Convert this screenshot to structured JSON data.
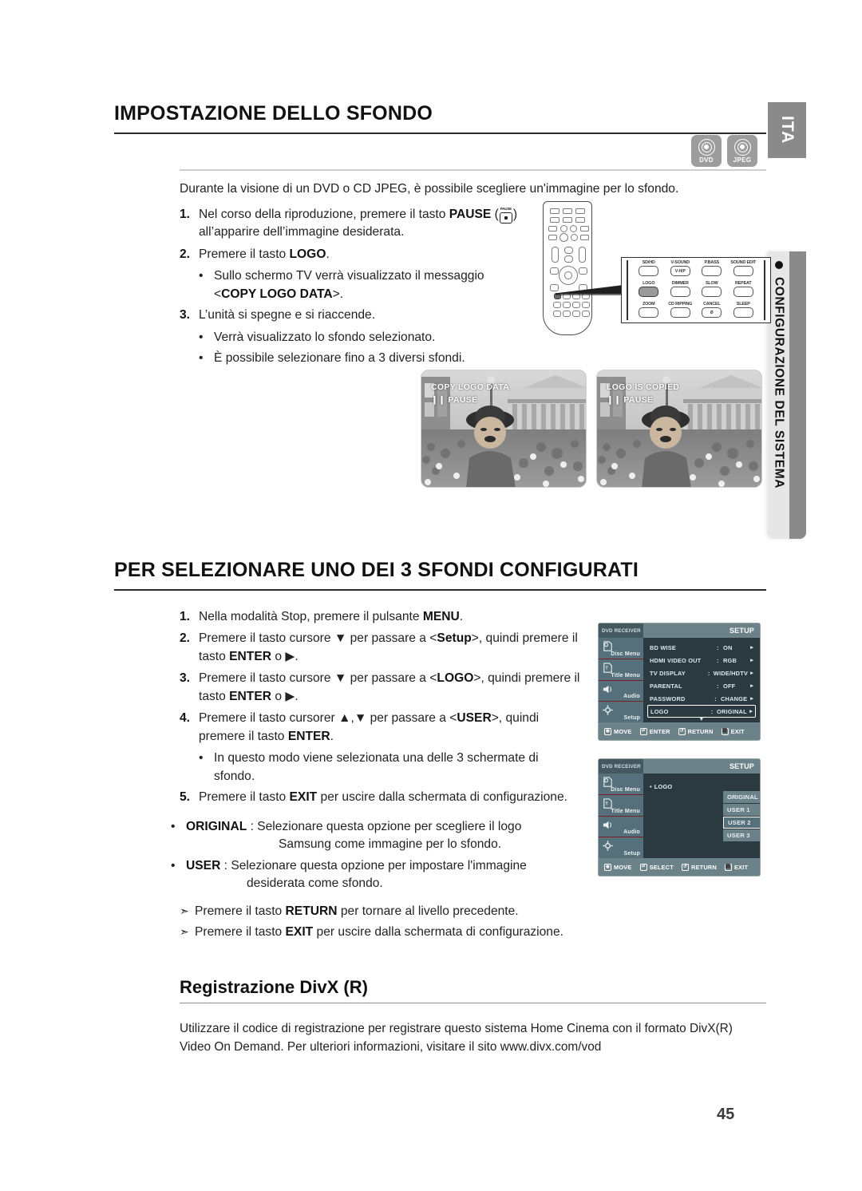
{
  "page": {
    "number": "45",
    "language_tab": "ITA",
    "chapter_tab": "CONFIGURAZIONE DEL SISTEMA"
  },
  "section1": {
    "heading": "IMPOSTAZIONE DELLO SFONDO",
    "badges": [
      {
        "label": "DVD",
        "icon": "disc-icon"
      },
      {
        "label": "JPEG",
        "icon": "disc-icon"
      }
    ],
    "intro": "Durante la visione di un DVD o CD JPEG, è possibile scegliere un'immagine per lo sfondo.",
    "steps": [
      {
        "num": "1.",
        "pre": "Nel corso della riproduzione, premere il tasto ",
        "bold": "PAUSE",
        "post": " (",
        "post2": ")",
        "line2": "all’apparire dell’immagine desiderata.",
        "bullets": []
      },
      {
        "num": "2.",
        "pre": "Premere il tasto ",
        "bold": "LOGO",
        "post": ".",
        "bullets": [
          {
            "pre": "Sullo schermo TV verrà visualizzato il messaggio",
            "line2_pre": "<",
            "line2_bold": "COPY LOGO DATA",
            "line2_post": ">."
          }
        ]
      },
      {
        "num": "3.",
        "pre": "L’unità si spegne e si riaccende.",
        "bold": "",
        "post": "",
        "bullets": [
          {
            "pre": "Verrà visualizzato lo sfondo selezionato."
          },
          {
            "pre": "È possibile selezionare fino a 3 diversi sfondi."
          }
        ]
      }
    ]
  },
  "remote": {
    "callout_keys": [
      {
        "label": "SD/HD",
        "text": "",
        "highlight": false
      },
      {
        "label": "V-SOUND",
        "text": "V-H/P",
        "highlight": false
      },
      {
        "label": "P.BASS",
        "text": "",
        "highlight": false
      },
      {
        "label": "SOUND EDIT",
        "text": "",
        "highlight": false
      },
      {
        "label": "LOGO",
        "text": "",
        "highlight": true
      },
      {
        "label": "DIMMER",
        "text": "",
        "highlight": false
      },
      {
        "label": "SLOW",
        "text": "",
        "highlight": false
      },
      {
        "label": "REPEAT",
        "text": "",
        "highlight": false
      },
      {
        "label": "ZOOM",
        "text": "",
        "highlight": false
      },
      {
        "label": "CD RIPPING",
        "text": "",
        "highlight": false
      },
      {
        "label": "CANCEL",
        "text": "Ø",
        "highlight": false
      },
      {
        "label": "SLEEP",
        "text": "",
        "highlight": false
      }
    ]
  },
  "tv_shots": [
    {
      "line1": "COPY LOGO DATA",
      "line2": "❙❙ PAUSE"
    },
    {
      "line1": "LOGO IS COPIED",
      "line2": "❙❙ PAUSE"
    }
  ],
  "section2": {
    "heading": "PER SELEZIONARE UNO DEI 3 SFONDI CONFIGURATI",
    "steps": [
      {
        "num": "1.",
        "pre": "Nella modalità Stop, premere il pulsante ",
        "bold": "MENU",
        "post": "."
      },
      {
        "num": "2.",
        "seg": [
          {
            "t": "Premere il tasto cursore ▼ per passare a <",
            "b": false
          },
          {
            "t": "Setup",
            "b": true
          },
          {
            "t": ">, quindi premere il",
            "b": false
          }
        ],
        "line2_seg": [
          {
            "t": "tasto ",
            "b": false
          },
          {
            "t": "ENTER",
            "b": true
          },
          {
            "t": " o ▶.",
            "b": false
          }
        ]
      },
      {
        "num": "3.",
        "seg": [
          {
            "t": "Premere il tasto cursore ▼ per passare a <",
            "b": false
          },
          {
            "t": "LOGO",
            "b": true
          },
          {
            "t": ">, quindi premere il",
            "b": false
          }
        ],
        "line2_seg": [
          {
            "t": "tasto ",
            "b": false
          },
          {
            "t": "ENTER",
            "b": true
          },
          {
            "t": " o ▶.",
            "b": false
          }
        ]
      },
      {
        "num": "4.",
        "seg": [
          {
            "t": "Premere il tasto cursorer ▲,▼ per passare a <",
            "b": false
          },
          {
            "t": "USER",
            "b": true
          },
          {
            "t": ">, quindi",
            "b": false
          }
        ],
        "line2_seg": [
          {
            "t": "premere il tasto ",
            "b": false
          },
          {
            "t": "ENTER",
            "b": true
          },
          {
            "t": ".",
            "b": false
          }
        ],
        "bullets": [
          {
            "line1": "In questo modo viene selezionata una delle 3 schermate di",
            "line2": "sfondo."
          }
        ]
      },
      {
        "num": "5.",
        "seg": [
          {
            "t": "Premere il tasto ",
            "b": false
          },
          {
            "t": "EXIT",
            "b": true
          },
          {
            "t": " per uscire dalla schermata di configurazione.",
            "b": false
          }
        ]
      }
    ],
    "definitions": [
      {
        "term": "ORIGINAL",
        "sep": " : ",
        "desc_line1": "Selezionare questa opzione per scegliere il logo",
        "desc_line2": "Samsung come immagine per lo sfondo."
      },
      {
        "term": "USER",
        "sep": " : ",
        "desc_line1": "Selezionare questa opzione per impostare l'immagine",
        "desc_line2": "desiderata come sfondo."
      }
    ],
    "notes": [
      {
        "pre": "Premere il tasto ",
        "bold": "RETURN",
        "post": " per tornare al livello precedente."
      },
      {
        "pre": "Premere il tasto ",
        "bold": "EXIT",
        "post": " per uscire dalla schermata di configurazione."
      }
    ]
  },
  "osd_menu_1": {
    "brand": "DVD RECEIVER",
    "title": "SETUP",
    "side_items": [
      {
        "label": "Disc Menu",
        "icon": "disc-menu-icon"
      },
      {
        "label": "Title Menu",
        "icon": "title-menu-icon"
      },
      {
        "label": "Audio",
        "icon": "speaker-icon"
      },
      {
        "label": "Setup",
        "icon": "gear-icon"
      }
    ],
    "rows": [
      {
        "label": "BD WISE",
        "value": "ON",
        "selected": false
      },
      {
        "label": "HDMI VIDEO OUT",
        "value": "RGB",
        "selected": false
      },
      {
        "label": "TV DISPLAY",
        "value": "WIDE/HDTV",
        "selected": false
      },
      {
        "label": "PARENTAL",
        "value": "OFF",
        "selected": false
      },
      {
        "label": "PASSWORD",
        "value": "CHANGE",
        "selected": false
      },
      {
        "label": "LOGO",
        "value": "ORIGINAL",
        "selected": true
      }
    ],
    "scroll_hint": "▼",
    "buttons": [
      {
        "key": "◉",
        "label": "MOVE"
      },
      {
        "key": "⏎",
        "label": "ENTER"
      },
      {
        "key": "↺",
        "label": "RETURN"
      },
      {
        "key": "⬛",
        "label": "EXIT"
      }
    ]
  },
  "osd_menu_2": {
    "brand": "DVD RECEIVER",
    "title": "SETUP",
    "side_items": [
      {
        "label": "Disc Menu",
        "icon": "disc-menu-icon"
      },
      {
        "label": "Title Menu",
        "icon": "title-menu-icon"
      },
      {
        "label": "Audio",
        "icon": "speaker-icon"
      },
      {
        "label": "Setup",
        "icon": "gear-icon"
      }
    ],
    "row_label": "LOGO",
    "options": [
      {
        "label": "ORIGINAL",
        "selected": false
      },
      {
        "label": "USER 1",
        "selected": false
      },
      {
        "label": "USER 2",
        "selected": true
      },
      {
        "label": "USER 3",
        "selected": false
      }
    ],
    "buttons": [
      {
        "key": "◉",
        "label": "MOVE"
      },
      {
        "key": "⏎",
        "label": "SELECT"
      },
      {
        "key": "↺",
        "label": "RETURN"
      },
      {
        "key": "⬛",
        "label": "EXIT"
      }
    ]
  },
  "section3": {
    "heading": "Registrazione DivX (R)",
    "body_line1": "Utilizzare il codice di registrazione per registrare questo sistema Home Cinema con il formato DivX(R)",
    "body_line2": "Video On Demand. Per ulteriori informazioni, visitare il sito www.divx.com/vod"
  }
}
